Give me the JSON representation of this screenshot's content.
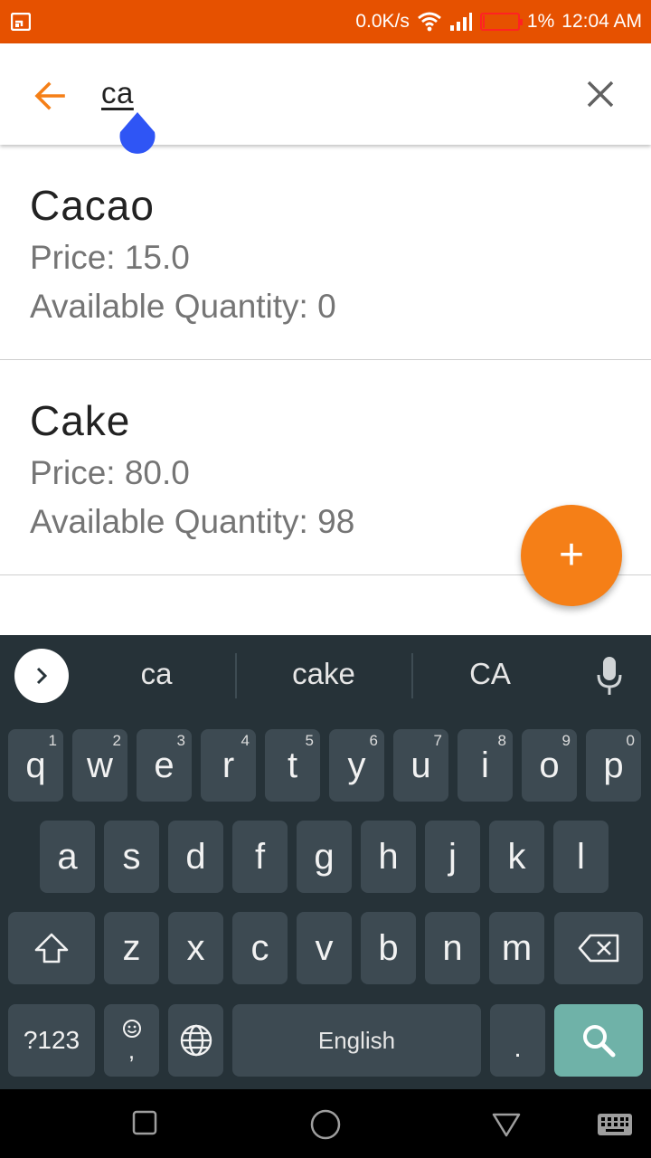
{
  "status_bar": {
    "net_speed": "0.0K/s",
    "battery_percent": "1%",
    "battery_level": 0.01,
    "time": "12:04 AM",
    "colors": {
      "background": "#e65100",
      "battery": "#ff2222"
    }
  },
  "search": {
    "query": "ca",
    "icons": {
      "back": "arrow-left-icon",
      "clear": "close-icon"
    },
    "accent": "#f57f17"
  },
  "results": [
    {
      "name": "Cacao",
      "price": "Price: 15.0",
      "quantity": "Available Quantity: 0"
    },
    {
      "name": "Cake",
      "price": "Price: 80.0",
      "quantity": "Available Quantity: 98"
    }
  ],
  "fab": {
    "label": "+",
    "color": "#f57f17"
  },
  "keyboard": {
    "suggestions": [
      "ca",
      "cake",
      "CA"
    ],
    "row1": [
      {
        "key": "q",
        "hint": "1"
      },
      {
        "key": "w",
        "hint": "2"
      },
      {
        "key": "e",
        "hint": "3"
      },
      {
        "key": "r",
        "hint": "4"
      },
      {
        "key": "t",
        "hint": "5"
      },
      {
        "key": "y",
        "hint": "6"
      },
      {
        "key": "u",
        "hint": "7"
      },
      {
        "key": "i",
        "hint": "8"
      },
      {
        "key": "o",
        "hint": "9"
      },
      {
        "key": "p",
        "hint": "0"
      }
    ],
    "row2": [
      "a",
      "s",
      "d",
      "f",
      "g",
      "h",
      "j",
      "k",
      "l"
    ],
    "row3": [
      "z",
      "x",
      "c",
      "v",
      "b",
      "n",
      "m"
    ],
    "symbols_label": "?123",
    "comma_label": ",",
    "space_label": "English",
    "period_label": ".",
    "search_color": "#6fb2a8"
  }
}
